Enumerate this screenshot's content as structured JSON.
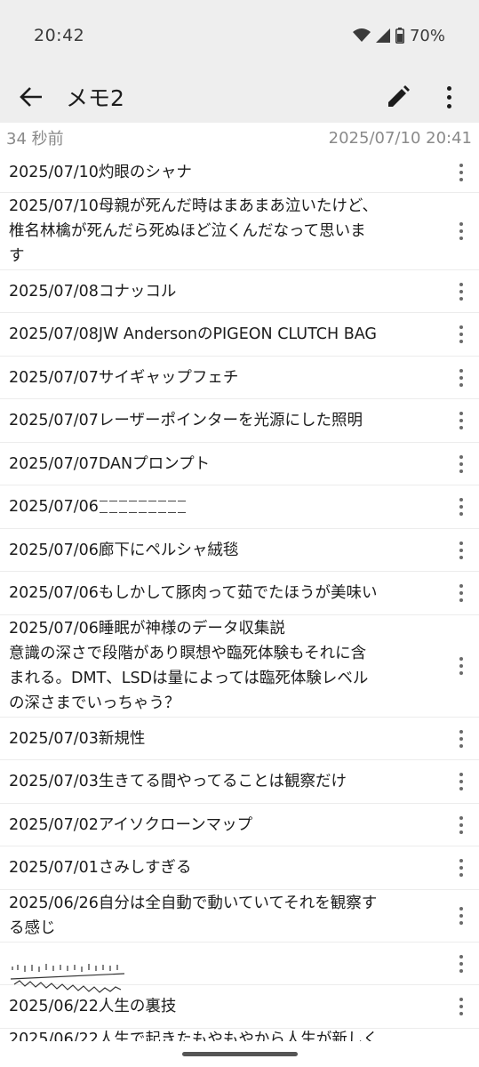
{
  "status_bar": {
    "time": "20:42",
    "battery": "70%"
  },
  "app_bar": {
    "title": "メモ2"
  },
  "meta": {
    "relative_time": "34 秒前",
    "timestamp": "2025/07/10 20:41"
  },
  "memos": [
    {
      "text": "2025/07/10灼眼のシャナ"
    },
    {
      "text": "2025/07/10母親が死んだ時はまあまあ泣いたけど、\n椎名林檎が死んだら死ぬほど泣くんだなって思いま\nす"
    },
    {
      "text": "2025/07/08コナッコル"
    },
    {
      "text": "2025/07/08JW AndersonのPIGEON CLUTCH BAG"
    },
    {
      "text": "2025/07/07サイギャップフェチ"
    },
    {
      "text": "2025/07/07レーザーポインターを光源にした照明"
    },
    {
      "text": "2025/07/07DANプロンプト"
    },
    {
      "text": "2025/07/06"
    },
    {
      "text": "2025/07/06廊下にペルシャ絨毯"
    },
    {
      "text": "2025/07/06もしかして豚肉って茹でたほうが美味い"
    },
    {
      "text": "2025/07/06睡眠が神様のデータ収集説\n意識の深さで段階があり瞑想や臨死体験もそれに含\nまれる。DMT、LSDは量によっては臨死体験レベル\nの深さまでいっちゃう？"
    },
    {
      "text": "2025/07/03新規性"
    },
    {
      "text": "2025/07/03生きてる間やってることは観察だけ"
    },
    {
      "text": "2025/07/02アイソクローンマップ"
    },
    {
      "text": "2025/07/01さみしすぎる"
    },
    {
      "text": "2025/06/26自分は全自動で動いていてそれを観察す\nる感じ"
    },
    {
      "text": ""
    },
    {
      "text": "2025/06/22人生の裏技"
    },
    {
      "text": "2025/06/22人生で起きたもやもやから人生が新しく"
    }
  ],
  "colors": {
    "bar_bg": "#eeeeee",
    "meta_text": "#8a8a8a",
    "divider": "#ececec"
  },
  "icons": [
    "back-arrow-icon",
    "pencil-icon",
    "more-vert-icon",
    "wifi-icon",
    "signal-icon",
    "battery-icon"
  ]
}
